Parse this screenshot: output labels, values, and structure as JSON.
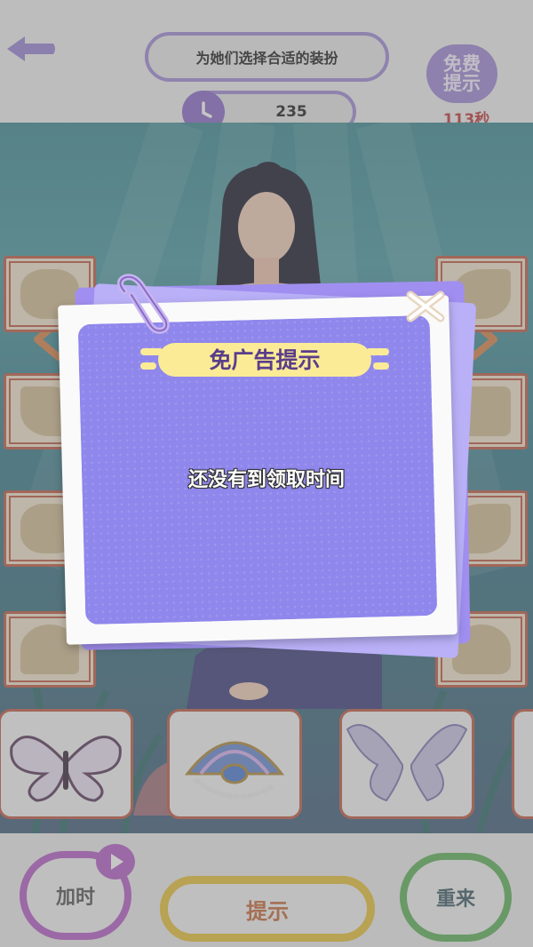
{
  "header": {
    "title": "为她们选择合适的装扮",
    "score": "235",
    "free_hint_line1": "免费",
    "free_hint_line2": "提示",
    "countdown": "113秒"
  },
  "slots_left": [
    "hair",
    "wings",
    "skirt",
    "coral"
  ],
  "slots_right": [
    "leaf",
    "comb",
    "tail",
    "jellyfish"
  ],
  "items": [
    "butterfly",
    "shell-fan",
    "fairy-wings"
  ],
  "footer": {
    "add_time": "加时",
    "hint": "提示",
    "restart": "重来"
  },
  "modal": {
    "title": "免广告提示",
    "message": "还没有到领取时间"
  },
  "colors": {
    "accent_purple": "#8a6bc8",
    "hint_yellow": "#e7c23a",
    "restart_green": "#5fb25a",
    "modal_purple": "#8f87ec",
    "countdown_red": "#c0393b"
  }
}
